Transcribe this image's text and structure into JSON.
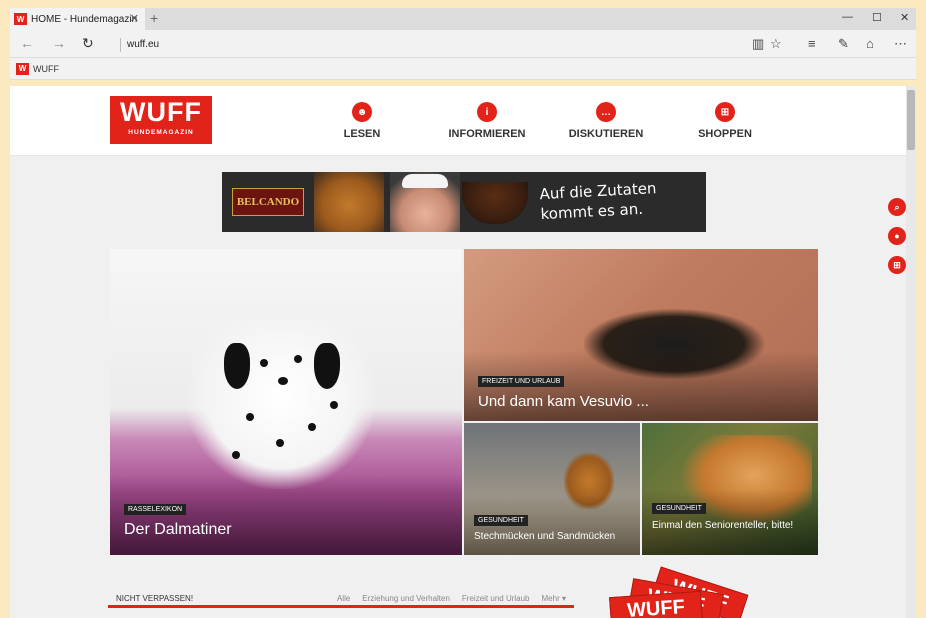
{
  "browser": {
    "tab_title": "HOME - Hundemagazin",
    "tab_favicon": "W",
    "url": "wuff.eu",
    "favorites": [
      {
        "label": "WUFF",
        "favicon": "W"
      }
    ]
  },
  "site": {
    "logo": {
      "main": "WUFF",
      "sub": "HUNDEMAGAZIN"
    },
    "nav": [
      {
        "label": "LESEN",
        "icon": "read-icon"
      },
      {
        "label": "INFORMIEREN",
        "icon": "info-icon"
      },
      {
        "label": "DISKUTIEREN",
        "icon": "chat-icon"
      },
      {
        "label": "SHOPPEN",
        "icon": "cart-icon"
      }
    ],
    "banner": {
      "brand": "BELCANDO",
      "text": "Auf die Zutaten kommt es an."
    },
    "side_actions": [
      "search-icon",
      "user-icon",
      "cart-icon"
    ],
    "tiles": [
      {
        "category": "RASSELEXIKON",
        "title": "Der Dalmatiner"
      },
      {
        "category": "FREIZEIT UND URLAUB",
        "title": "Und dann kam Vesuvio ..."
      },
      {
        "category": "GESUNDHEIT",
        "title": "Stechmücken und Sandmücken"
      },
      {
        "category": "GESUNDHEIT",
        "title": "Einmal den Seniorenteller, bitte!"
      }
    ],
    "section": {
      "title": "NICHT VERPASSEN!",
      "filters": [
        "Alle",
        "Erziehung und Verhalten",
        "Freizeit und Urlaub",
        "Mehr"
      ]
    }
  },
  "colors": {
    "brand_red": "#e2231a",
    "frame": "#fbe9c0"
  }
}
